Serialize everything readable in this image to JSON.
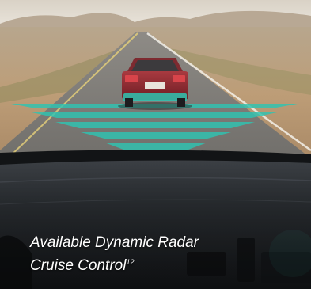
{
  "feature_card": {
    "caption_line1": "Available Dynamic Radar",
    "caption_line2": "Cruise Control",
    "footnote": "12",
    "colors": {
      "radar": "#2fc4b2",
      "sky": "#e7e1d6",
      "desert": "#b89c78",
      "road": "#7d7b77",
      "dashboard": "#24282c",
      "car_body": "#8e2730"
    }
  }
}
